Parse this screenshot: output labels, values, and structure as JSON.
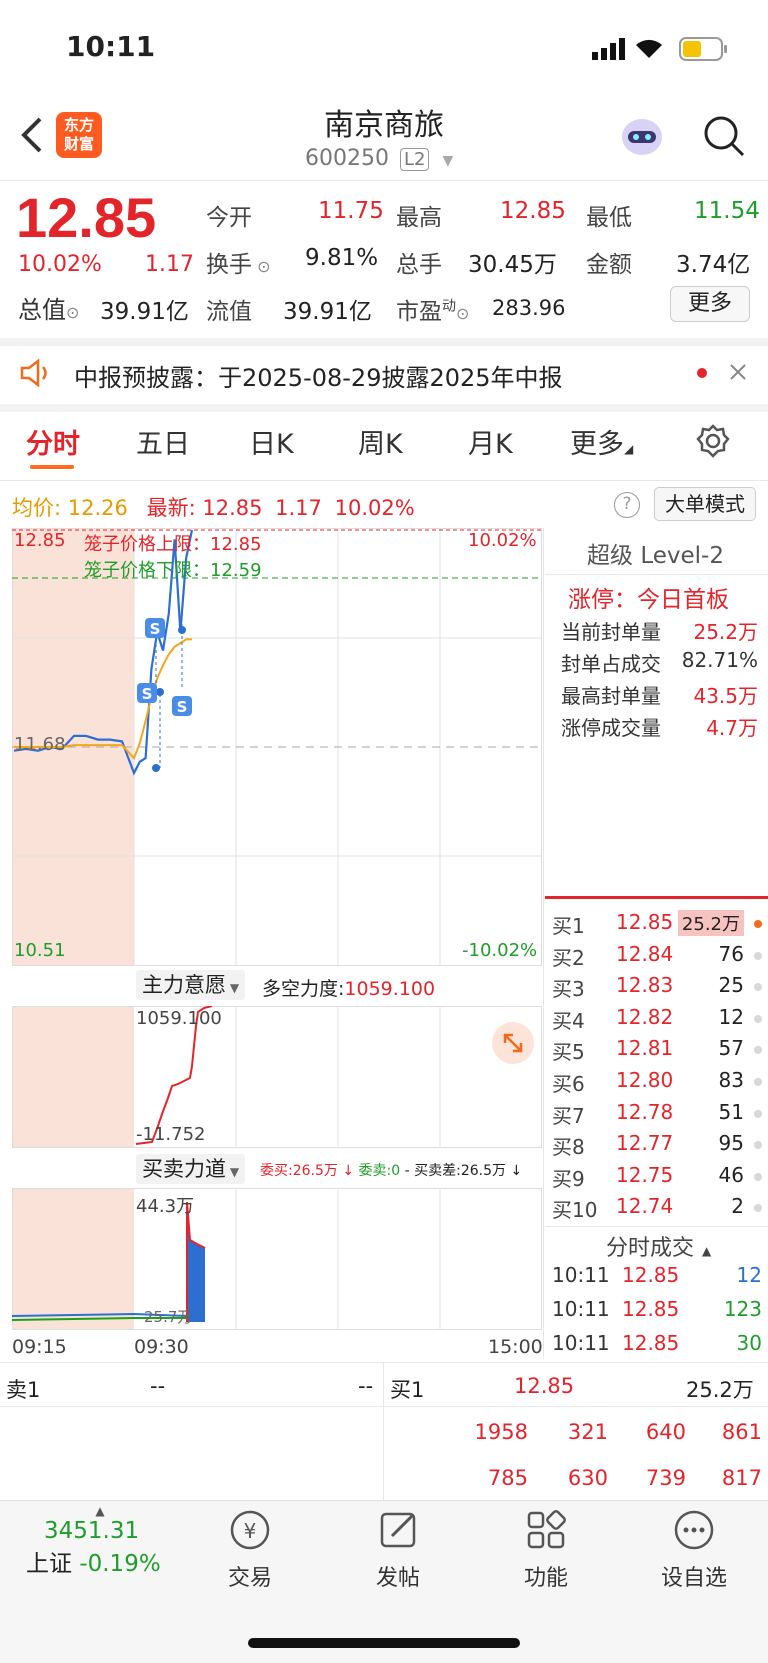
{
  "status_bar": {
    "time": "10:11"
  },
  "header": {
    "title": "南京商旅",
    "code": "600250",
    "level_badge": "L2"
  },
  "quote": {
    "price": "12.85",
    "change_pct": "10.02%",
    "change": "1.17",
    "open_label": "今开",
    "open": "11.75",
    "high_label": "最高",
    "high": "12.85",
    "low_label": "最低",
    "low": "11.54",
    "turnover_label": "换手",
    "turnover": "9.81%",
    "volume_label": "总手",
    "volume": "30.45万",
    "amount_label": "金额",
    "amount": "3.74亿",
    "mktcap_label": "总值",
    "mktcap": "39.91亿",
    "float_label": "流值",
    "float": "39.91亿",
    "pe_label": "市盈",
    "pe_sup": "动",
    "pe": "283.96",
    "more_button": "更多"
  },
  "notice": {
    "text": "中报预披露：于2025-08-29披露2025年中报"
  },
  "tabs": {
    "t1": "分时",
    "t2": "五日",
    "t3": "日K",
    "t4": "周K",
    "t5": "月K",
    "t6": "更多"
  },
  "info_bar": {
    "avg_label": "均价:",
    "avg": "12.26",
    "latest_label": "最新:",
    "latest": "12.85",
    "chg": "1.17",
    "pct": "10.02%",
    "big_order_mode": "大单模式"
  },
  "chart_labels": {
    "top_price": "12.85",
    "top_pct": "10.02%",
    "mid_price": "11.68",
    "bottom_price": "10.51",
    "bottom_pct": "-10.02%",
    "cage_upper": "笼子价格上限：12.85",
    "cage_lower": "笼子价格下限：12.59",
    "main_will": "主力意愿",
    "long_short_label": "多空力度:",
    "long_short_value": "1059.100",
    "ind_top": "1059.100",
    "ind_bottom": "-11.752",
    "buy_sell_power": "买卖力道",
    "entrust_buy": "委买:26.5万",
    "entrust_sell": "委卖:0",
    "entrust_diff": "买卖差:26.5万",
    "vol_top": "44.3万",
    "vol_mid": "25.7万",
    "time_start": "09:15",
    "time_open": "09:30",
    "time_end": "15:00"
  },
  "chart_data": {
    "type": "line",
    "title": "",
    "ylim": [
      10.51,
      12.85
    ],
    "reference_price": 11.68,
    "series": [
      {
        "values": [
          11.66,
          11.67,
          11.66,
          11.68,
          11.67,
          11.74,
          11.74,
          11.72,
          11.72,
          11.71,
          11.54,
          11.6,
          11.62,
          12.1,
          12.3,
          12.2,
          12.4,
          12.8,
          12.3,
          12.7,
          12.85
        ]
      },
      {
        "values": [
          11.68,
          11.68,
          11.68,
          11.68,
          11.68,
          11.69,
          11.69,
          11.69,
          11.69,
          11.69,
          11.62,
          11.7,
          11.82,
          11.95,
          12.05,
          12.12,
          12.18,
          12.22,
          12.24,
          12.26,
          12.26
        ]
      }
    ]
  },
  "level2": {
    "title": "超级 Level-2",
    "limit_up": "涨停：今日首板",
    "stats": [
      {
        "label": "当前封单量",
        "value": "25.2万"
      },
      {
        "label": "封单占成交",
        "value": "82.71%"
      },
      {
        "label": "最高封单量",
        "value": "43.5万"
      },
      {
        "label": "涨停成交量",
        "value": "4.7万"
      }
    ]
  },
  "order_book": [
    {
      "label": "买1",
      "price": "12.85",
      "qty": "25.2万"
    },
    {
      "label": "买2",
      "price": "12.84",
      "qty": "76"
    },
    {
      "label": "买3",
      "price": "12.83",
      "qty": "25"
    },
    {
      "label": "买4",
      "price": "12.82",
      "qty": "12"
    },
    {
      "label": "买5",
      "price": "12.81",
      "qty": "57"
    },
    {
      "label": "买6",
      "price": "12.80",
      "qty": "83"
    },
    {
      "label": "买7",
      "price": "12.78",
      "qty": "51"
    },
    {
      "label": "买8",
      "price": "12.77",
      "qty": "95"
    },
    {
      "label": "买9",
      "price": "12.75",
      "qty": "46"
    },
    {
      "label": "买10",
      "price": "12.74",
      "qty": "2"
    }
  ],
  "trades": {
    "title": "分时成交",
    "rows": [
      {
        "time": "10:11",
        "price": "12.85",
        "qty": "12"
      },
      {
        "time": "10:11",
        "price": "12.85",
        "qty": "123"
      },
      {
        "time": "10:11",
        "price": "12.85",
        "qty": "30"
      }
    ]
  },
  "queue": {
    "sell_label": "卖1",
    "sell_price": "--",
    "sell_qty": "--",
    "buy_label": "买1",
    "buy_price": "12.85",
    "buy_qty": "25.2万",
    "row1": [
      "1958",
      "321",
      "640",
      "861"
    ],
    "row2": [
      "785",
      "630",
      "739",
      "817"
    ]
  },
  "bottom_nav": {
    "index_value": "3451.31",
    "index_name": "上证",
    "index_pct": "-0.19%",
    "trade": "交易",
    "post": "发帖",
    "function": "功能",
    "watchlist": "设自选"
  }
}
